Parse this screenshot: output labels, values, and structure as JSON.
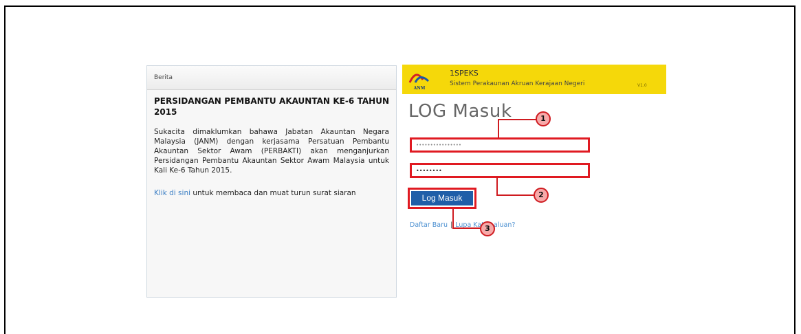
{
  "news": {
    "header": "Berita",
    "title": "PERSIDANGAN PEMBANTU AKAUNTAN KE-6 TAHUN 2015",
    "body": "Sukacita dimaklumkan bahawa Jabatan Akauntan Negara Malaysia (JANM) dengan kerjasama Persatuan Pembantu Akauntan Sektor Awam (PERBAKTI) akan menganjurkan Persidangan Pembantu Akauntan Sektor Awam Malaysia untuk Kali Ke-6 Tahun 2015.",
    "link_text": "Klik di sini",
    "link_suffix": " untuk membaca dan muat turun surat siaran"
  },
  "banner": {
    "logo_text": "ANM",
    "app_name": "1SPEKS",
    "app_subtitle": "Sistem Perakaunan Akruan Kerajaan Negeri",
    "version": "V1.0",
    "color": "#f5d80a"
  },
  "login": {
    "title": "LOG Masuk",
    "username_value": "••••••••••••••••",
    "password_value": "••••••••",
    "submit_label": "Log Masuk",
    "register_link": "Daftar Baru",
    "separator": "|",
    "forgot_link": "Lupa Kata Laluan?",
    "button_color": "#1f5ea8"
  },
  "callouts": {
    "marker_1": "1",
    "marker_2": "2",
    "marker_3": "3",
    "highlight_color": "#e01a22"
  }
}
